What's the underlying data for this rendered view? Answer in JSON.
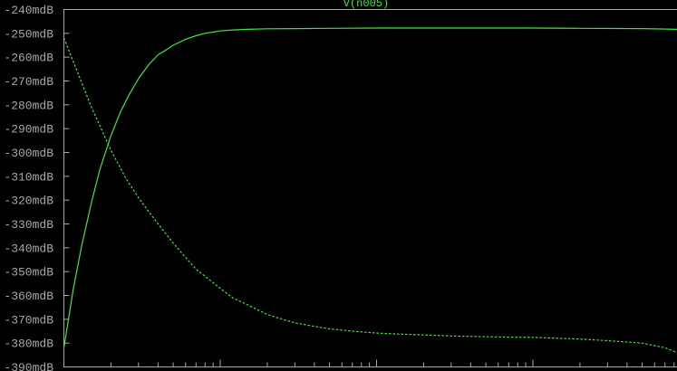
{
  "chart_data": {
    "type": "line",
    "title": "V(n005)",
    "x_scale": "log",
    "xlim": [
      1,
      10000
    ],
    "ylim": [
      -390,
      -240
    ],
    "y_unit": "mdB",
    "grid": false,
    "yticks": [
      "-240mdB",
      "-250mdB",
      "-260mdB",
      "-270mdB",
      "-280mdB",
      "-290mdB",
      "-300mdB",
      "-310mdB",
      "-320mdB",
      "-330mdB",
      "-340mdB",
      "-350mdB",
      "-360mdB",
      "-370mdB",
      "-380mdB",
      "-390mdB"
    ],
    "series": [
      {
        "style": "solid",
        "color": "#3ee63e",
        "x": [
          1,
          1.15,
          1.3,
          1.5,
          1.7,
          2,
          2.3,
          2.6,
          3,
          3.5,
          4,
          4.5,
          5,
          6,
          7,
          8,
          9,
          10,
          12,
          15,
          20,
          30,
          50,
          100,
          200,
          500,
          1000,
          2000,
          5000,
          10000
        ],
        "y": [
          -382,
          -357,
          -339,
          -321,
          -307,
          -293,
          -283,
          -276,
          -269,
          -263,
          -259,
          -257,
          -255,
          -252.5,
          -251,
          -250,
          -249.5,
          -249,
          -248.6,
          -248.3,
          -248.1,
          -248,
          -247.9,
          -247.8,
          -247.8,
          -247.8,
          -247.8,
          -247.9,
          -248,
          -248.4
        ]
      },
      {
        "style": "dashed",
        "color": "#3ee63e",
        "x": [
          1,
          1.2,
          1.5,
          2,
          2.5,
          3,
          3.5,
          4,
          5,
          6,
          7,
          8,
          10,
          12,
          15,
          20,
          25,
          30,
          40,
          50,
          70,
          100,
          150,
          200,
          300,
          500,
          700,
          1000,
          1500,
          2000,
          3000,
          5000,
          7000,
          10000
        ],
        "y": [
          -252,
          -265,
          -281,
          -299,
          -311,
          -319,
          -325,
          -330,
          -338,
          -344,
          -349,
          -352,
          -357,
          -361,
          -364,
          -368,
          -370,
          -371.5,
          -373,
          -374,
          -375,
          -375.8,
          -376.3,
          -376.6,
          -377,
          -377.3,
          -377.5,
          -377.6,
          -378,
          -378.3,
          -379,
          -380,
          -382,
          -386
        ]
      }
    ]
  }
}
